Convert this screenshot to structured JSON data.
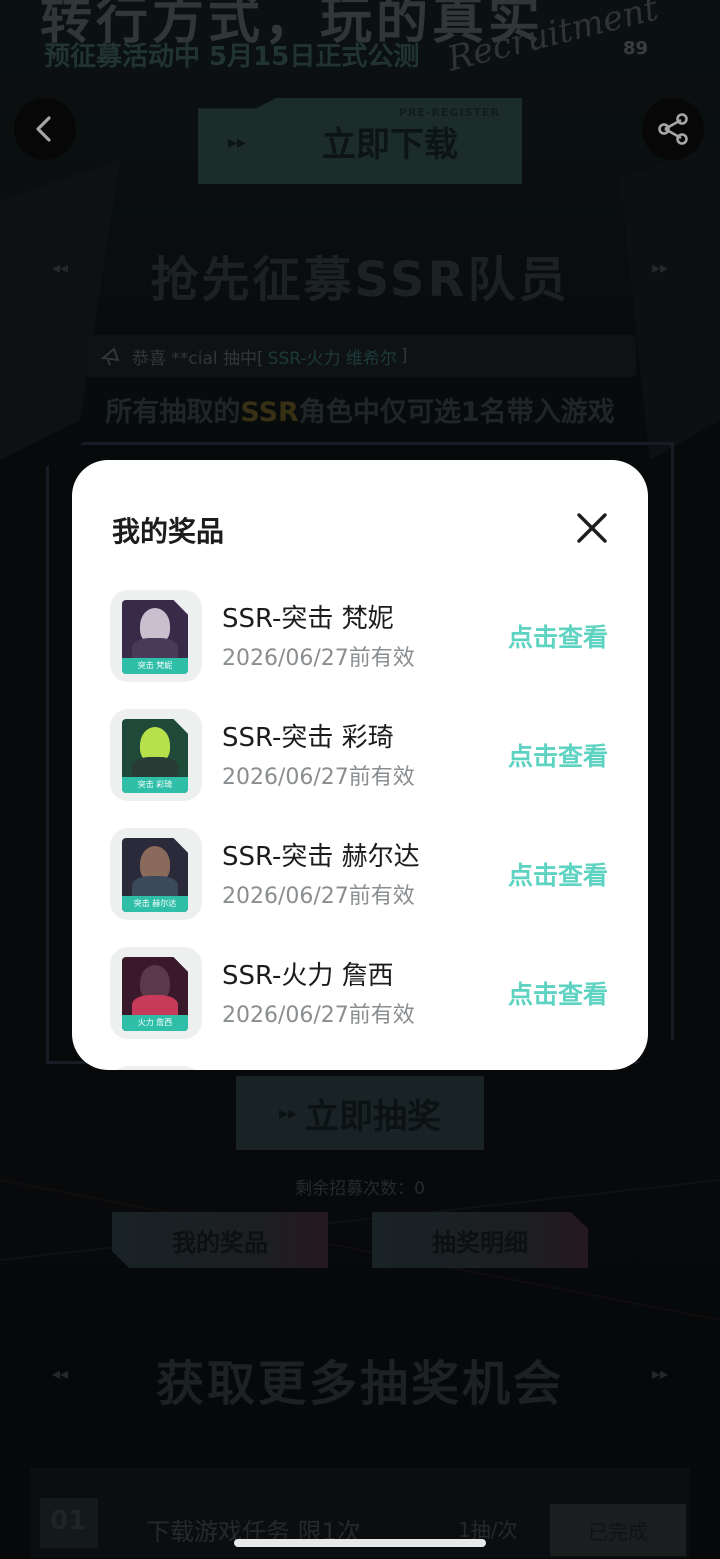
{
  "banner": {
    "headline": "转行方式，玩的真实",
    "subline": "预征募活动中 5月15日正式公测",
    "logo_text": "Recruitment",
    "logo_number": "89"
  },
  "download": {
    "tag": "PRE-REGISTER",
    "label": "立即下载"
  },
  "recruit_section": {
    "title": "抢先征募SSR队员",
    "notice_prefix": "恭喜 **cial 抽中[",
    "notice_highlight": "SSR-火力 维希尔",
    "notice_suffix": "]",
    "rule_prefix": "所有抽取的",
    "rule_highlight": "SSR",
    "rule_suffix": "角色中仅可选1名带入游戏"
  },
  "draw": {
    "button_label": "立即抽奖",
    "remaining_text": "剩余招募次数：0",
    "my_prizes_label": "我的奖品",
    "draw_detail_label": "抽奖明细"
  },
  "more_section": {
    "title": "获取更多抽奖机会",
    "task_number": "01",
    "task_name": "下载游戏任务 限1次",
    "task_count": "1抽/次",
    "task_status": "已完成"
  },
  "modal": {
    "title": "我的奖品",
    "items": [
      {
        "name": "SSR-突击 梵妮",
        "expiry": "2026/06/27前有效",
        "action": "点击查看",
        "card_caption": "突击 梵妮",
        "colors": [
          "#3a2a4a",
          "#c9c0cf",
          "#4a3a5a"
        ]
      },
      {
        "name": "SSR-突击 彩琦",
        "expiry": "2026/06/27前有效",
        "action": "点击查看",
        "card_caption": "突击 彩琦",
        "colors": [
          "#1f4a3a",
          "#b8e04a",
          "#2a3a34"
        ]
      },
      {
        "name": "SSR-突击 赫尔达",
        "expiry": "2026/06/27前有效",
        "action": "点击查看",
        "card_caption": "突击 赫尔达",
        "colors": [
          "#2a2a3a",
          "#8a6a5a",
          "#3a4a5a"
        ]
      },
      {
        "name": "SSR-火力 詹西",
        "expiry": "2026/06/27前有效",
        "action": "点击查看",
        "card_caption": "火力 詹西",
        "colors": [
          "#3a1a2a",
          "#5a3a4a",
          "#c83a5a"
        ]
      }
    ]
  }
}
